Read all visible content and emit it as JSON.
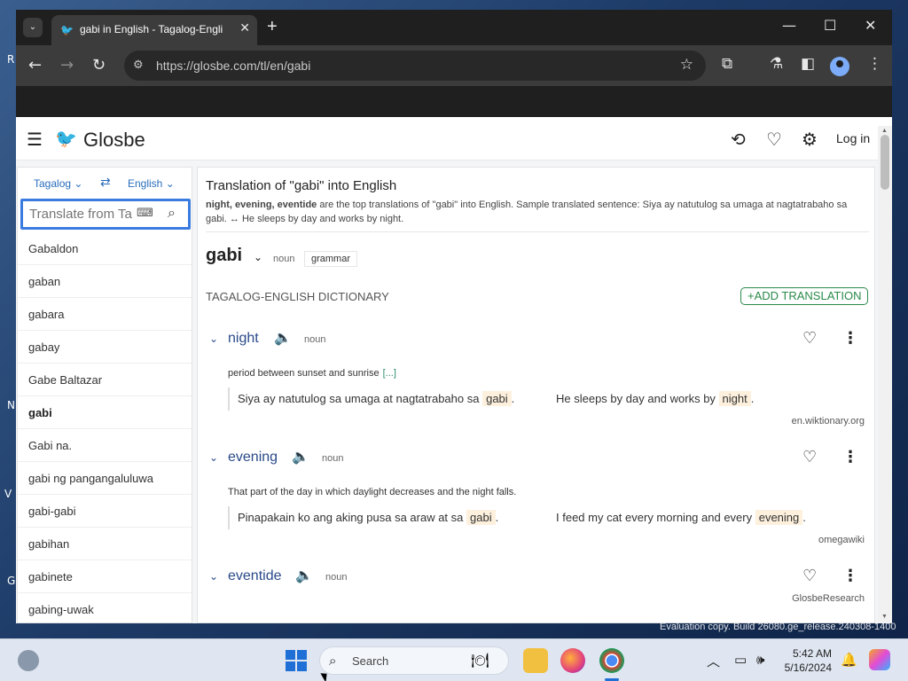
{
  "browser": {
    "tab_title": "gabi in English - Tagalog-Engli",
    "tab_close": "✕",
    "new_tab": "+",
    "url": "https://glosbe.com/tl/en/gabi",
    "window_controls": {
      "minimize": "—",
      "maximize": "☐",
      "close": "✕"
    }
  },
  "site": {
    "logo": "Glosbe",
    "login": "Log in"
  },
  "left": {
    "source_lang": "Tagalog ⌄",
    "target_lang": "English ⌄",
    "swap": "⇄",
    "search_placeholder": "Translate from Ta",
    "words": [
      "Gabaldon",
      "gaban",
      "gabara",
      "gabay",
      "Gabe Baltazar",
      "gabi",
      "Gabi na.",
      "gabi ng pangangaluluwa",
      "gabi-gabi",
      "gabihan",
      "gabinete",
      "gabing-uwak"
    ],
    "active_word": "gabi"
  },
  "main": {
    "title": "Translation of \"gabi\" into English",
    "summary_bold": "night, evening, eventide",
    "summary_rest": " are the top translations of \"gabi\" into English. Sample translated sentence: Siya ay natutulog sa umaga at nagtatrabaho sa gabi. ↔ He sleeps by day and works by night.",
    "headword": "gabi",
    "headword_pos": "noun",
    "grammar": "grammar",
    "dict_label": "TAGALOG-ENGLISH DICTIONARY",
    "add_translation": "+ADD TRANSLATION",
    "entries": [
      {
        "word": "night",
        "pos": "noun",
        "definition": "period between sunset and sunrise",
        "def_more": "[...]",
        "ex_src_before": "Siya ay natutulog sa umaga at nagtatrabaho sa ",
        "ex_src_hl": "gabi",
        "ex_src_after": ".",
        "ex_tgt_before": "He sleeps by day and works by ",
        "ex_tgt_hl": "night",
        "ex_tgt_after": ".",
        "source": "en.wiktionary.org"
      },
      {
        "word": "evening",
        "pos": "noun",
        "definition": "That part of the day in which daylight decreases and the night falls.",
        "ex_src_before": "Pinapakain ko ang aking pusa sa araw at sa ",
        "ex_src_hl": "gabi",
        "ex_src_after": ".",
        "ex_tgt_before": "I feed my cat every morning and every ",
        "ex_tgt_hl": "evening",
        "ex_tgt_after": ".",
        "source": "omegawiki"
      },
      {
        "word": "eventide",
        "pos": "noun",
        "source": "GlosbeResearch"
      }
    ]
  },
  "desktop": {
    "watermark": "Evaluation copy. Build 26080.ge_release.240308-1400"
  },
  "taskbar": {
    "search_label": "Search",
    "time": "5:42 AM",
    "date": "5/16/2024"
  },
  "colors": {
    "link_blue": "#2a4a8a",
    "accent_green": "#2a8a4a",
    "highlight": "#fdf0dd",
    "chrome_dark": "#1f1f1f",
    "focus_blue": "#3a7be0"
  }
}
